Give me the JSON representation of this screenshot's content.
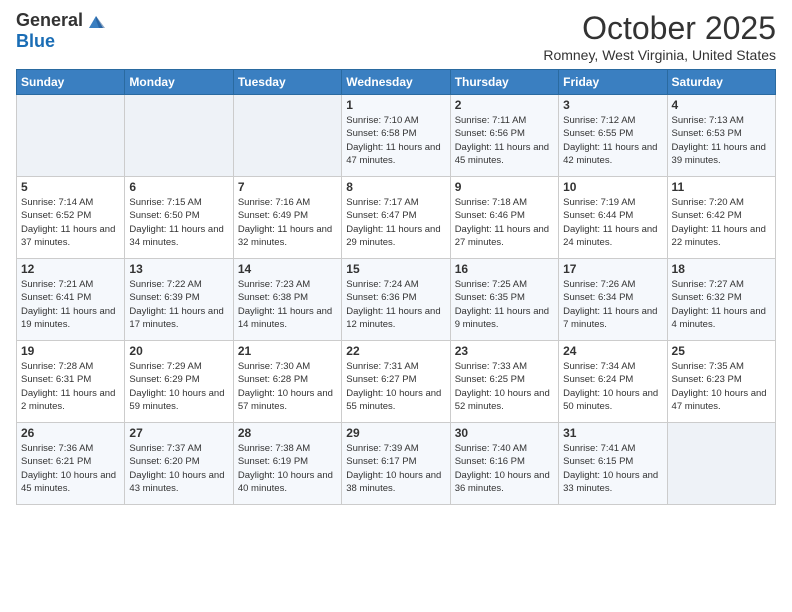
{
  "logo": {
    "general": "General",
    "blue": "Blue"
  },
  "header": {
    "month": "October 2025",
    "location": "Romney, West Virginia, United States"
  },
  "weekdays": [
    "Sunday",
    "Monday",
    "Tuesday",
    "Wednesday",
    "Thursday",
    "Friday",
    "Saturday"
  ],
  "weeks": [
    [
      {
        "day": "",
        "info": ""
      },
      {
        "day": "",
        "info": ""
      },
      {
        "day": "",
        "info": ""
      },
      {
        "day": "1",
        "info": "Sunrise: 7:10 AM\nSunset: 6:58 PM\nDaylight: 11 hours and 47 minutes."
      },
      {
        "day": "2",
        "info": "Sunrise: 7:11 AM\nSunset: 6:56 PM\nDaylight: 11 hours and 45 minutes."
      },
      {
        "day": "3",
        "info": "Sunrise: 7:12 AM\nSunset: 6:55 PM\nDaylight: 11 hours and 42 minutes."
      },
      {
        "day": "4",
        "info": "Sunrise: 7:13 AM\nSunset: 6:53 PM\nDaylight: 11 hours and 39 minutes."
      }
    ],
    [
      {
        "day": "5",
        "info": "Sunrise: 7:14 AM\nSunset: 6:52 PM\nDaylight: 11 hours and 37 minutes."
      },
      {
        "day": "6",
        "info": "Sunrise: 7:15 AM\nSunset: 6:50 PM\nDaylight: 11 hours and 34 minutes."
      },
      {
        "day": "7",
        "info": "Sunrise: 7:16 AM\nSunset: 6:49 PM\nDaylight: 11 hours and 32 minutes."
      },
      {
        "day": "8",
        "info": "Sunrise: 7:17 AM\nSunset: 6:47 PM\nDaylight: 11 hours and 29 minutes."
      },
      {
        "day": "9",
        "info": "Sunrise: 7:18 AM\nSunset: 6:46 PM\nDaylight: 11 hours and 27 minutes."
      },
      {
        "day": "10",
        "info": "Sunrise: 7:19 AM\nSunset: 6:44 PM\nDaylight: 11 hours and 24 minutes."
      },
      {
        "day": "11",
        "info": "Sunrise: 7:20 AM\nSunset: 6:42 PM\nDaylight: 11 hours and 22 minutes."
      }
    ],
    [
      {
        "day": "12",
        "info": "Sunrise: 7:21 AM\nSunset: 6:41 PM\nDaylight: 11 hours and 19 minutes."
      },
      {
        "day": "13",
        "info": "Sunrise: 7:22 AM\nSunset: 6:39 PM\nDaylight: 11 hours and 17 minutes."
      },
      {
        "day": "14",
        "info": "Sunrise: 7:23 AM\nSunset: 6:38 PM\nDaylight: 11 hours and 14 minutes."
      },
      {
        "day": "15",
        "info": "Sunrise: 7:24 AM\nSunset: 6:36 PM\nDaylight: 11 hours and 12 minutes."
      },
      {
        "day": "16",
        "info": "Sunrise: 7:25 AM\nSunset: 6:35 PM\nDaylight: 11 hours and 9 minutes."
      },
      {
        "day": "17",
        "info": "Sunrise: 7:26 AM\nSunset: 6:34 PM\nDaylight: 11 hours and 7 minutes."
      },
      {
        "day": "18",
        "info": "Sunrise: 7:27 AM\nSunset: 6:32 PM\nDaylight: 11 hours and 4 minutes."
      }
    ],
    [
      {
        "day": "19",
        "info": "Sunrise: 7:28 AM\nSunset: 6:31 PM\nDaylight: 11 hours and 2 minutes."
      },
      {
        "day": "20",
        "info": "Sunrise: 7:29 AM\nSunset: 6:29 PM\nDaylight: 10 hours and 59 minutes."
      },
      {
        "day": "21",
        "info": "Sunrise: 7:30 AM\nSunset: 6:28 PM\nDaylight: 10 hours and 57 minutes."
      },
      {
        "day": "22",
        "info": "Sunrise: 7:31 AM\nSunset: 6:27 PM\nDaylight: 10 hours and 55 minutes."
      },
      {
        "day": "23",
        "info": "Sunrise: 7:33 AM\nSunset: 6:25 PM\nDaylight: 10 hours and 52 minutes."
      },
      {
        "day": "24",
        "info": "Sunrise: 7:34 AM\nSunset: 6:24 PM\nDaylight: 10 hours and 50 minutes."
      },
      {
        "day": "25",
        "info": "Sunrise: 7:35 AM\nSunset: 6:23 PM\nDaylight: 10 hours and 47 minutes."
      }
    ],
    [
      {
        "day": "26",
        "info": "Sunrise: 7:36 AM\nSunset: 6:21 PM\nDaylight: 10 hours and 45 minutes."
      },
      {
        "day": "27",
        "info": "Sunrise: 7:37 AM\nSunset: 6:20 PM\nDaylight: 10 hours and 43 minutes."
      },
      {
        "day": "28",
        "info": "Sunrise: 7:38 AM\nSunset: 6:19 PM\nDaylight: 10 hours and 40 minutes."
      },
      {
        "day": "29",
        "info": "Sunrise: 7:39 AM\nSunset: 6:17 PM\nDaylight: 10 hours and 38 minutes."
      },
      {
        "day": "30",
        "info": "Sunrise: 7:40 AM\nSunset: 6:16 PM\nDaylight: 10 hours and 36 minutes."
      },
      {
        "day": "31",
        "info": "Sunrise: 7:41 AM\nSunset: 6:15 PM\nDaylight: 10 hours and 33 minutes."
      },
      {
        "day": "",
        "info": ""
      }
    ]
  ]
}
